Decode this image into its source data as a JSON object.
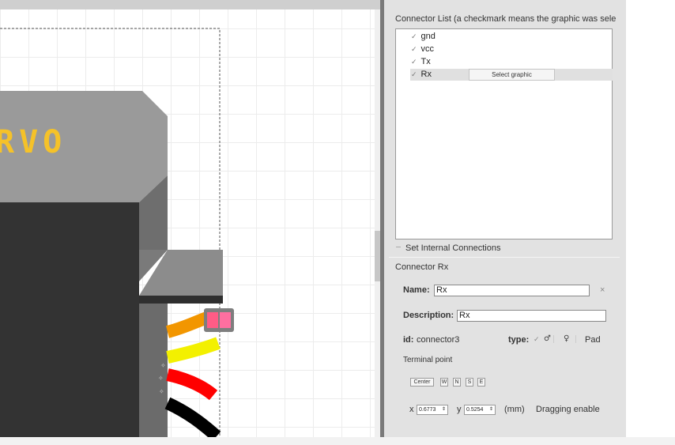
{
  "canvas": {
    "logo_text": "RVO"
  },
  "panel": {
    "connector_list_title": "Connector List (a checkmark means the graphic was sele",
    "connectors": [
      {
        "label": "gnd",
        "checked": true
      },
      {
        "label": "vcc",
        "checked": true
      },
      {
        "label": "Tx",
        "checked": true
      },
      {
        "label": "Rx",
        "checked": true
      }
    ],
    "check_glyph": "✓",
    "select_graphic_label": "Select graphic",
    "internal_connections_label": "Set Internal Connections",
    "connector_header": "Connector Rx",
    "name_label": "Name:",
    "name_value": "Rx",
    "clear_glyph": "×",
    "description_label": "Description:",
    "description_value": "Rx",
    "id_label": "id:",
    "id_value": "connector3",
    "type_label": "type:",
    "type_male": "♂",
    "type_female": "♀",
    "type_pad": "Pad",
    "terminal_point_label": "Terminal point",
    "terminal_buttons": [
      "Center",
      "W",
      "N",
      "S",
      "E"
    ],
    "x_label": "x",
    "x_value": "0.6773",
    "y_label": "y",
    "y_value": "0.5254",
    "unit_label": "(mm)",
    "dragging_label": "Dragging enable"
  },
  "colors": {
    "splitter": "#7a7a7a",
    "panel_bg": "#e2e2e2",
    "logo_yellow": "#f5c229",
    "wire_orange": "#f29600",
    "wire_yellow": "#f3f000",
    "wire_red": "#ff0000",
    "wire_black": "#000000",
    "connector_pink": "#ff6f9a"
  }
}
